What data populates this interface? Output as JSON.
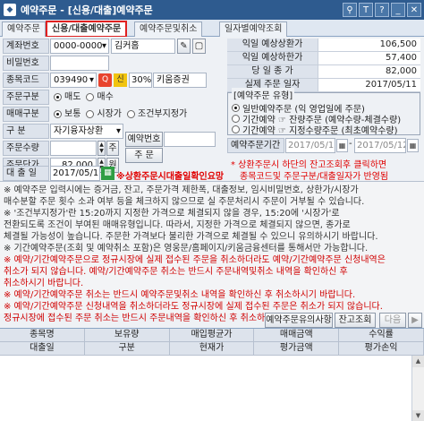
{
  "window": {
    "title": "예약주문 - [신용/대출]예약주문",
    "icon": "app-icon"
  },
  "tabs": [
    {
      "label": "예약주문"
    },
    {
      "label": "신용/대출예약주문"
    },
    {
      "label": "예약주문및취소"
    },
    {
      "label": "일자별예약조회"
    }
  ],
  "form": {
    "account_label": "계좌번호",
    "account_value": "0000-0000",
    "account_name": "김커홈",
    "password_label": "비밀번호",
    "stock_code_label": "종목코드",
    "stock_code": "039490",
    "stock_badge": "신",
    "stock_margin": "30%",
    "stock_name": "키움증권",
    "order_type_label": "주문구분",
    "order_type_options": [
      "매도",
      "매수"
    ],
    "order_method_label": "매매구분",
    "order_method_options": [
      "보통",
      "시장가",
      "조건부지정가"
    ],
    "category_label": "구  분",
    "category_value": "자기융자상환",
    "qty_label": "주문수량",
    "qty_value": "",
    "qty_btn": "주",
    "price_label": "주문단가",
    "price_value": "82,000",
    "price_btn": "원",
    "loan_date_label": "대 출 일",
    "loan_date": "2017/05/11",
    "loan_warning": "※상환주문시대출일확인요망",
    "reserve_no_btn": "예약번호",
    "order_btn": "주  문"
  },
  "summary": [
    {
      "k": "익일 예상상환가",
      "v": "106,500"
    },
    {
      "k": "익일 예상하한가",
      "v": "57,400"
    },
    {
      "k": "당 일 종 가",
      "v": "82,000"
    },
    {
      "k": "실제 주문 일자",
      "v": "2017/05/11"
    }
  ],
  "reserve_type": {
    "header": "[예약주문 유형]",
    "options": [
      "일반예약주문 (익 영업일에 주문)",
      "기간예약 ☞ 잔량주문 (예약수량-체결수량)",
      "기간예약 ☞ 지정수량주문 (최초예약수량)"
    ]
  },
  "period": {
    "label": "예약주문기간",
    "from": "2017/05/11",
    "to": "2017/05/12"
  },
  "notice": {
    "line1": "* 상환주문시 하단의 잔고조회후 클릭하면",
    "line2": "종목코드및 주문구분/대출일자가 반영됨"
  },
  "info": [
    {
      "t": "※ 예약주문 입력시에는 증거금, 잔고, 주문가격 제한폭, 대출정보, 임시비밀번호, 상한가/시장가",
      "c": "blk"
    },
    {
      "t": "   매수분할 주문 횟수 소과 여부 등을 체크하지 않으므로 실 주문처리시 주문이 거부될 수 있습니다.",
      "c": "blk"
    },
    {
      "t": "※ '조건부지정가'란 15:20까지 지정한 가격으로 체결되지 않을 경우, 15:20에 '시장가'로",
      "c": "blk"
    },
    {
      "t": "   전환되도록 조건이 부여된 매매유형입니다. 따라서, 지정한 가격으로 체결되지 않으면, 종가로",
      "c": "blk"
    },
    {
      "t": "   체결될 가능성이 높습니다. 주문한 가격보다 불리한 가격으로 체결될 수 있으니 유의하시기 바랍니다.",
      "c": "blk"
    },
    {
      "t": "※ 기간예약주문(조회 및 예약취소 포함)은 영웅문/홈페이지/키움금융센터를 통해서만 가능합니다.",
      "c": "blk"
    },
    {
      "t": "※ 예약/기간예약주문으로 정규시장에 실제 접수된 주문을 취소하더라도 예약/기간예약주문 신청내역은",
      "c": "red"
    },
    {
      "t": "   취소가 되지 않습니다. 예약/기간예약주문 취소는 반드시 주문내역및취소 내역을 확인하신 후",
      "c": "red"
    },
    {
      "t": "   취소하시기 바랍니다.",
      "c": "red"
    },
    {
      "t": "※ 예약/기간예약주문 취소는 반드시 예약주문및취소 내역을 확인하신 후 취소하시기 바랍니다.",
      "c": "red"
    },
    {
      "t": "※ 예약/기간예약주문 신청내역을 취소하더라도 정규시장에 실제 접수된 주문은 취소가 되지 않습니다.",
      "c": "red"
    },
    {
      "t": "   정규시장에 접수된 주문 취소는 반드시 주문내역을 확인하신 후 취소하시기 바랍니다.",
      "c": "red"
    }
  ],
  "bottom_buttons": {
    "notice_btn": "예약주문유의사항",
    "balance_btn": "잔고조회",
    "next_btn": "다음"
  },
  "grid": {
    "row1": [
      "종목명",
      "보유량",
      "매입평균가",
      "매매금액",
      "수익률"
    ],
    "row2": [
      "대출일",
      "구분",
      "현재가",
      "평가금액",
      "평가손익"
    ]
  }
}
